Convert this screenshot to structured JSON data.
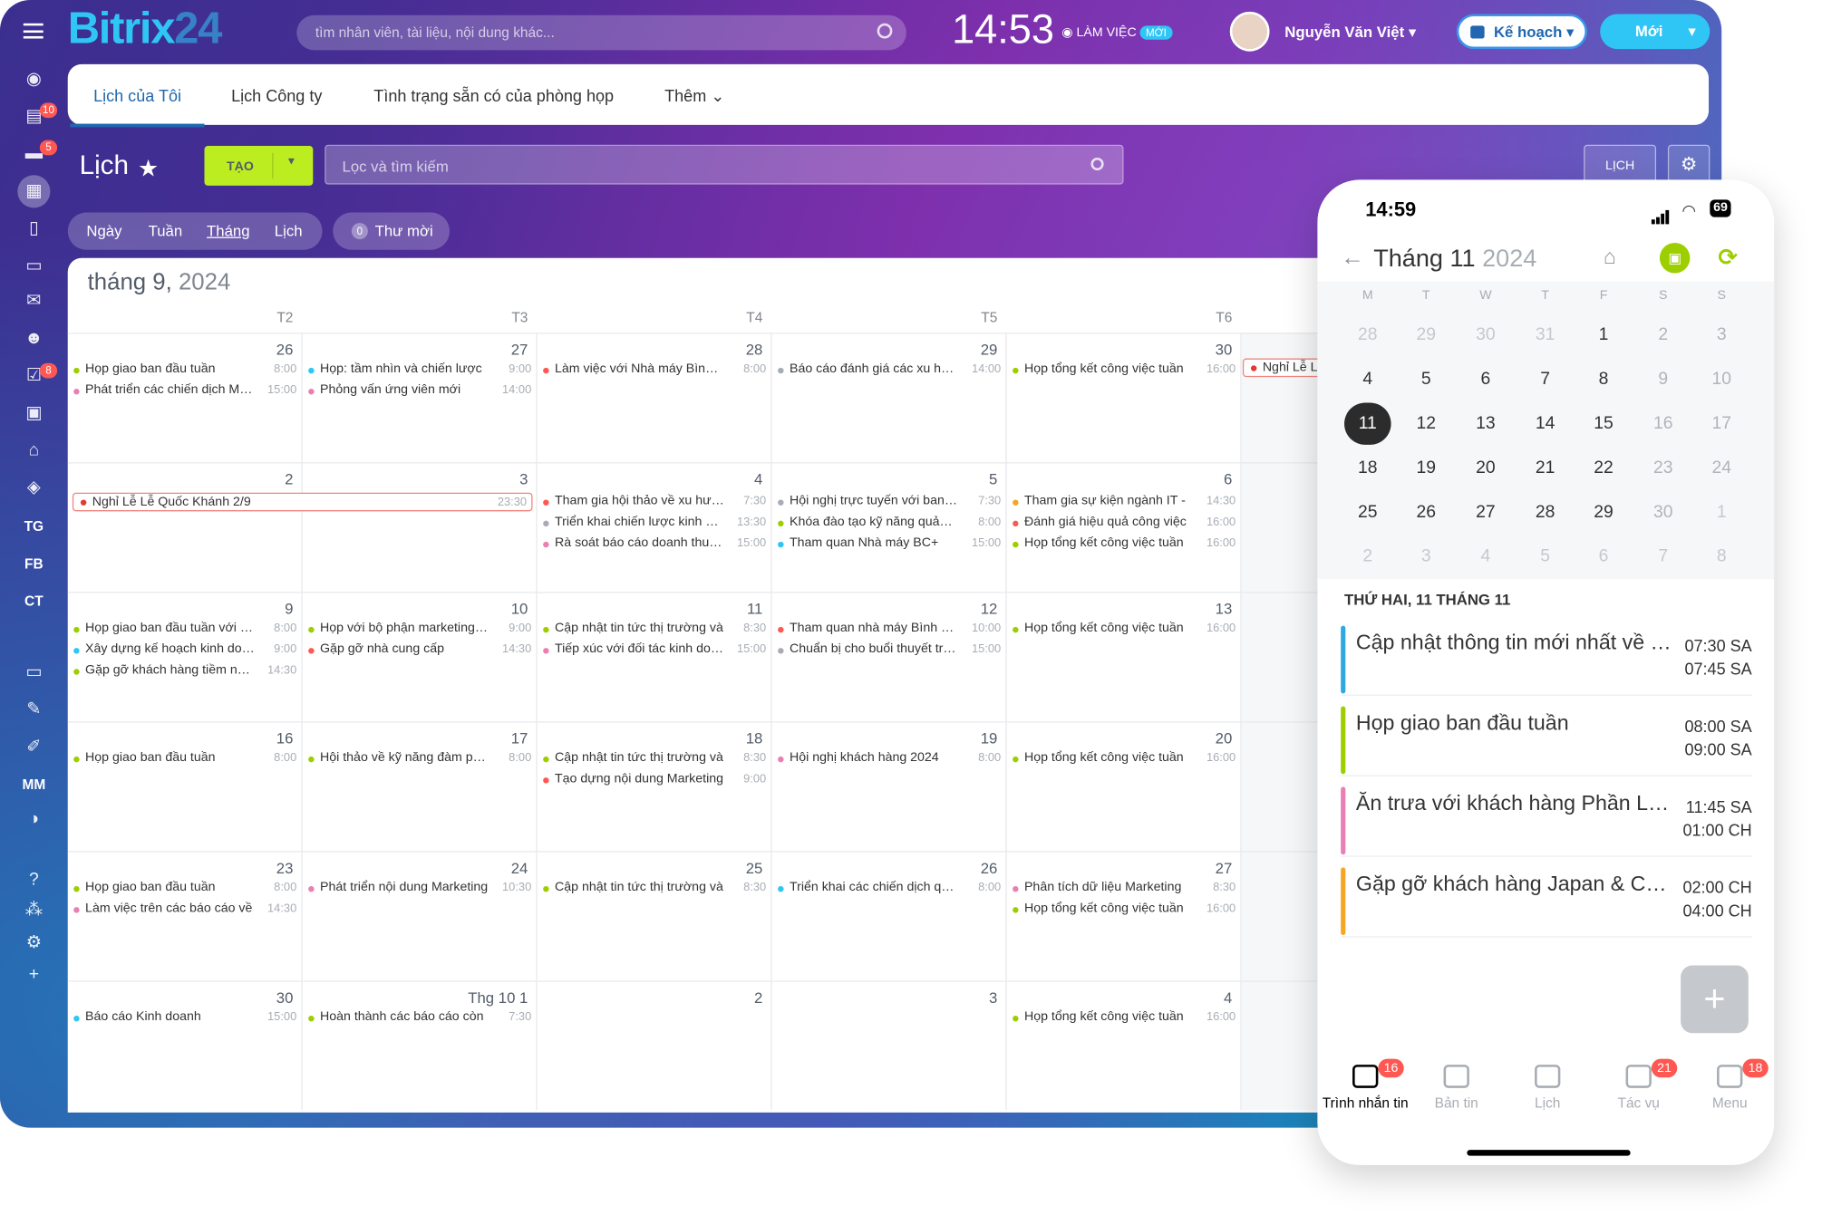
{
  "topbar": {
    "logo_main": "Bitrix",
    "logo_num": "24",
    "search_placeholder": "tìm nhân viên, tài liệu, nội dung khác...",
    "clock": "14:53",
    "work_status": "LÀM VIỆC",
    "work_badge": "MỚI",
    "user_name": "Nguyễn Văn Việt",
    "plan_label": "Kế hoạch",
    "new_label": "Mới"
  },
  "left_sidebar": {
    "badges": [
      "10",
      "5",
      "8"
    ],
    "text_items": [
      "TG",
      "FB",
      "CT",
      "MM"
    ]
  },
  "tabs": [
    "Lịch của Tôi",
    "Lịch Công ty",
    "Tình trạng sẵn có của phòng họp",
    "Thêm"
  ],
  "header": {
    "title": "Lịch",
    "create_label": "TẠO",
    "filter_placeholder": "Lọc và tìm kiếm",
    "calendar_btn": "LỊCH"
  },
  "views": {
    "items": [
      "Ngày",
      "Tuần",
      "Tháng",
      "Lịch"
    ],
    "active": "Tháng",
    "invites_count": "0",
    "invites_label": "Thư mời"
  },
  "month": {
    "title_month": "tháng 9,",
    "title_year": "2024",
    "day_headers": [
      "T2",
      "T3",
      "T4",
      "T5",
      "T6"
    ]
  },
  "weeks": [
    {
      "days": [
        "26",
        "27",
        "28",
        "29",
        "30"
      ],
      "events": [
        [
          {
            "t": "Họp giao ban đầu tuần",
            "tm": "8:00",
            "c": "#9dcf00"
          },
          {
            "t": "Phát triển các chiến dịch Marketing",
            "tm": "15:00",
            "c": "#e97fb4"
          }
        ],
        [
          {
            "t": "Họp: tầm nhìn và chiến lược",
            "tm": "9:00",
            "c": "#2fc6f6"
          },
          {
            "t": "Phỏng vấn ứng viên mới",
            "tm": "14:00",
            "c": "#e97fb4"
          }
        ],
        [
          {
            "t": "Làm việc với Nhà máy Bình Dương",
            "tm": "8:00",
            "c": "#ff5752"
          }
        ],
        [
          {
            "t": "Báo cáo đánh giá các xu hướng",
            "tm": "14:00",
            "c": "#a8adb4"
          }
        ],
        [
          {
            "t": "Họp tổng kết công việc tuần",
            "tm": "16:00",
            "c": "#9dcf00"
          }
        ]
      ],
      "holiday_next": "Nghỉ Lễ Lễ"
    },
    {
      "days": [
        "2",
        "3",
        "4",
        "5",
        "6"
      ],
      "holiday": {
        "t": "Nghỉ Lễ Lễ Quốc Khánh 2/9",
        "tm": "23:30"
      },
      "events": [
        [],
        [],
        [
          {
            "t": "Tham gia hội thảo về xu hướng",
            "tm": "7:30",
            "c": "#ff5752"
          },
          {
            "t": "Triển khai chiến lược kinh doanh",
            "tm": "13:30",
            "c": "#a8adb4"
          },
          {
            "t": "Rà soát báo cáo doanh thu và",
            "tm": "15:00",
            "c": "#e97fb4"
          }
        ],
        [
          {
            "t": "Hội nghị trực tuyến với ban lãnh đạo",
            "tm": "7:30",
            "c": "#a8adb4"
          },
          {
            "t": "Khóa đào tạo kỹ năng quản lý",
            "tm": "8:00",
            "c": "#9dcf00"
          },
          {
            "t": "Tham quan Nhà máy BC+",
            "tm": "15:00",
            "c": "#2fc6f6"
          }
        ],
        [
          {
            "t": "Tham gia sự kiện ngành IT -",
            "tm": "14:30",
            "c": "#f5a623"
          },
          {
            "t": "Đánh giá hiệu quả công việc",
            "tm": "16:00",
            "c": "#ff5752"
          },
          {
            "t": "Họp tổng kết công việc tuần",
            "tm": "16:00",
            "c": "#9dcf00"
          }
        ]
      ]
    },
    {
      "days": [
        "9",
        "10",
        "11",
        "12",
        "13"
      ],
      "events": [
        [
          {
            "t": "Họp giao ban đầu tuần với đội ngũ",
            "tm": "8:00",
            "c": "#9dcf00"
          },
          {
            "t": "Xây dựng kế hoạch kinh doanh",
            "tm": "9:00",
            "c": "#2fc6f6"
          },
          {
            "t": "Gặp gỡ khách hàng tiềm năng",
            "tm": "14:30",
            "c": "#9dcf00"
          }
        ],
        [
          {
            "t": "Họp với bộ phận marketing để",
            "tm": "9:00",
            "c": "#9dcf00"
          },
          {
            "t": "Gặp gỡ nhà cung cấp",
            "tm": "14:30",
            "c": "#ff5752"
          }
        ],
        [
          {
            "t": "Cập nhật tin tức thị trường và",
            "tm": "8:30",
            "c": "#9dcf00"
          },
          {
            "t": "Tiếp xúc với đối tác kinh doanh",
            "tm": "15:00",
            "c": "#e97fb4"
          }
        ],
        [
          {
            "t": "Tham quan nhà máy Bình Chánh",
            "tm": "10:00",
            "c": "#ff5752"
          },
          {
            "t": "Chuẩn bị cho buổi thuyết trình",
            "tm": "15:00",
            "c": "#a8adb4"
          }
        ],
        [
          {
            "t": "Họp tổng kết công việc tuần",
            "tm": "16:00",
            "c": "#9dcf00"
          }
        ]
      ]
    },
    {
      "days": [
        "16",
        "17",
        "18",
        "19",
        "20"
      ],
      "events": [
        [
          {
            "t": "Họp giao ban đầu tuần",
            "tm": "8:00",
            "c": "#9dcf00"
          }
        ],
        [
          {
            "t": "Hội thảo về kỹ năng đàm phán",
            "tm": "8:00",
            "c": "#9dcf00"
          }
        ],
        [
          {
            "t": "Cập nhật tin tức thị trường và",
            "tm": "8:30",
            "c": "#9dcf00"
          },
          {
            "t": "Tạo dựng nội dung Marketing",
            "tm": "9:00",
            "c": "#ff5752"
          }
        ],
        [
          {
            "t": "Hội nghị khách hàng 2024",
            "tm": "8:00",
            "c": "#e97fb4"
          }
        ],
        [
          {
            "t": "Họp tổng kết công việc tuần",
            "tm": "16:00",
            "c": "#9dcf00"
          }
        ]
      ]
    },
    {
      "days": [
        "23",
        "24",
        "25",
        "26",
        "27"
      ],
      "events": [
        [
          {
            "t": "Họp giao ban đầu tuần",
            "tm": "8:00",
            "c": "#9dcf00"
          },
          {
            "t": "Làm việc trên các báo cáo về",
            "tm": "14:30",
            "c": "#e97fb4"
          }
        ],
        [
          {
            "t": "Phát triển nội dung Marketing",
            "tm": "10:30",
            "c": "#e97fb4"
          }
        ],
        [
          {
            "t": "Cập nhật tin tức thị trường và",
            "tm": "8:30",
            "c": "#9dcf00"
          }
        ],
        [
          {
            "t": "Triển khai các chiến dịch quảng",
            "tm": "8:00",
            "c": "#2fc6f6"
          }
        ],
        [
          {
            "t": "Phân tích dữ liệu Marketing",
            "tm": "8:30",
            "c": "#e97fb4"
          },
          {
            "t": "Họp tổng kết công việc tuần",
            "tm": "16:00",
            "c": "#9dcf00"
          }
        ]
      ]
    },
    {
      "days": [
        "30",
        "Thg 10 1",
        "2",
        "3",
        "4"
      ],
      "events": [
        [
          {
            "t": "Báo cáo Kinh doanh",
            "tm": "15:00",
            "c": "#2fc6f6"
          }
        ],
        [
          {
            "t": "Hoàn thành các báo cáo còn",
            "tm": "7:30",
            "c": "#9dcf00"
          }
        ],
        [],
        [],
        [
          {
            "t": "Họp tổng kết công việc tuần",
            "tm": "16:00",
            "c": "#9dcf00"
          }
        ]
      ]
    }
  ],
  "phone": {
    "time": "14:59",
    "battery": "69",
    "month_label": "Tháng 11",
    "year_label": "2024",
    "weekdays": [
      "M",
      "T",
      "W",
      "T",
      "F",
      "S",
      "S"
    ],
    "rows": [
      [
        "28",
        "29",
        "30",
        "31",
        "1",
        "2",
        "3"
      ],
      [
        "4",
        "5",
        "6",
        "7",
        "8",
        "9",
        "10"
      ],
      [
        "11",
        "12",
        "13",
        "14",
        "15",
        "16",
        "17"
      ],
      [
        "18",
        "19",
        "20",
        "21",
        "22",
        "23",
        "24"
      ],
      [
        "25",
        "26",
        "27",
        "28",
        "29",
        "30",
        "1"
      ],
      [
        "2",
        "3",
        "4",
        "5",
        "6",
        "7",
        "8"
      ]
    ],
    "selected_day": "11",
    "day_header": "THỨ HAI, 11 THÁNG 11",
    "events": [
      {
        "name": "Cập nhật thông tin mới nhất về thị trường",
        "start": "07:30 SA",
        "end": "07:45 SA",
        "color": "#2fa8e0"
      },
      {
        "name": "Họp giao ban đầu tuần",
        "start": "08:00 SA",
        "end": "09:00 SA",
        "color": "#9dcf00"
      },
      {
        "name": "Ăn trưa với khách hàng Phần Lan",
        "start": "11:45 SA",
        "end": "01:00 CH",
        "color": "#e97fb4"
      },
      {
        "name": "Gặp gỡ khách hàng Japan & Co...",
        "start": "02:00 CH",
        "end": "04:00 CH",
        "color": "#f5a623"
      }
    ],
    "nav": [
      {
        "label": "Trình nhắn tin",
        "badge": "16"
      },
      {
        "label": "Bản tin",
        "badge": ""
      },
      {
        "label": "Lịch",
        "badge": ""
      },
      {
        "label": "Tác vụ",
        "badge": "21"
      },
      {
        "label": "Menu",
        "badge": "18"
      }
    ]
  }
}
